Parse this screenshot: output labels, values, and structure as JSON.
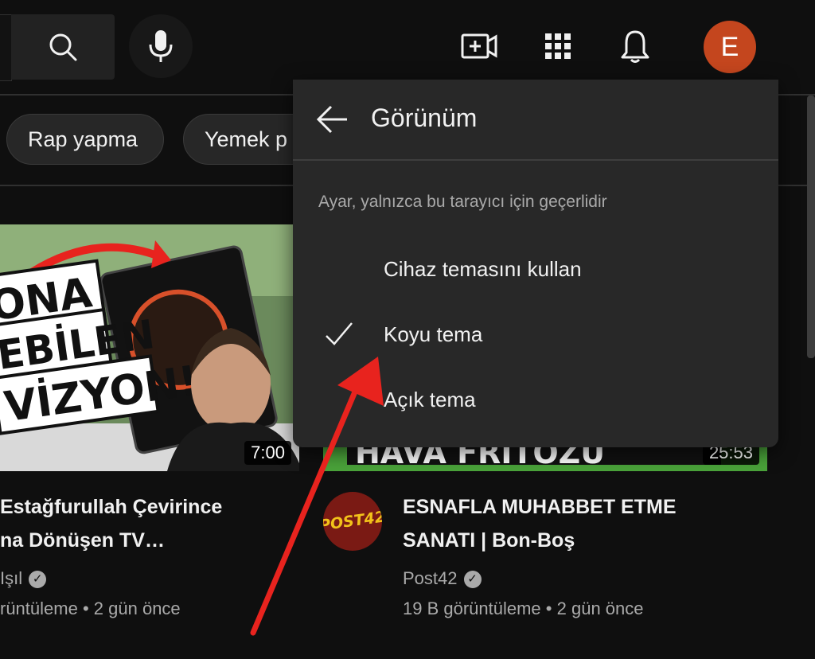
{
  "header": {
    "avatar_letter": "E",
    "icons": [
      "search-icon",
      "mic-icon",
      "create-video-icon",
      "apps-grid-icon",
      "notifications-bell-icon"
    ]
  },
  "chips": [
    {
      "label": "Rap yapma"
    },
    {
      "label": "Yemek p"
    }
  ],
  "videos": [
    {
      "thumbnail_text": [
        "ONA",
        "EBİLEN",
        "VİZYON!"
      ],
      "duration": "7:00",
      "title_line1": "Estağfurullah Çevirince",
      "title_line2": "na Dönüşen TV…",
      "channel": "Işıl",
      "views": "rüntüleme",
      "age": "2 gün önce"
    },
    {
      "thumbnail_text": "HAVA FRİTÖZÜ",
      "duration": "25:53",
      "title_line1": "ESNAFLA MUHABBET ETME",
      "title_line2": "SANATI | Bon-Boş",
      "channel_avatar_text": "POST42",
      "channel": "Post42",
      "views": "19 B görüntüleme",
      "age": "2 gün önce"
    }
  ],
  "menu": {
    "title": "Görünüm",
    "note": "Ayar, yalnızca bu tarayıcı için geçerlidir",
    "items": [
      {
        "label": "Cihaz temasını kullan",
        "selected": false
      },
      {
        "label": "Koyu tema",
        "selected": true
      },
      {
        "label": "Açık tema",
        "selected": false
      }
    ]
  },
  "meta_separator": "•",
  "colors": {
    "background": "#0f0f0f",
    "menu_bg": "#282828",
    "avatar": "#c4461e",
    "annotation_arrow": "#e8231e"
  }
}
